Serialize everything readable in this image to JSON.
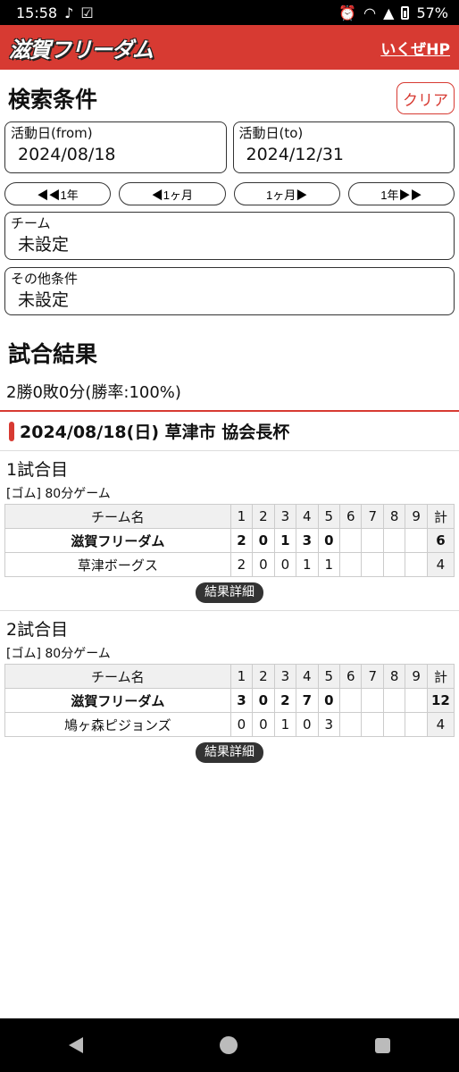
{
  "status": {
    "time": "15:58",
    "battery": "57%"
  },
  "app": {
    "logo": "滋賀フリーダム",
    "hp_link": "いくぜHP"
  },
  "search": {
    "title": "検索条件",
    "clear": "クリア",
    "from_label": "活動日(from)",
    "from_value": "2024/08/18",
    "to_label": "活動日(to)",
    "to_value": "2024/12/31",
    "nav": [
      "◀◀1年",
      "◀1ヶ月",
      "1ヶ月▶",
      "1年▶▶"
    ],
    "team_label": "チーム",
    "team_value": "未設定",
    "other_label": "その他条件",
    "other_value": "未設定"
  },
  "results": {
    "title": "試合結果",
    "record": "2勝0敗0分(勝率:100%)",
    "event": "2024/08/18(日) 草津市 協会長杯",
    "games": [
      {
        "title": "1試合目",
        "type": "[ゴム] 80分ゲーム",
        "header": [
          "チーム名",
          "1",
          "2",
          "3",
          "4",
          "5",
          "6",
          "7",
          "8",
          "9",
          "計"
        ],
        "rows": [
          {
            "team": "滋賀フリーダム",
            "scores": [
              "2",
              "0",
              "1",
              "3",
              "0",
              "",
              "",
              "",
              ""
            ],
            "total": "6",
            "bold": true
          },
          {
            "team": "草津ボーグス",
            "scores": [
              "2",
              "0",
              "0",
              "1",
              "1",
              "",
              "",
              "",
              ""
            ],
            "total": "4",
            "bold": false
          }
        ],
        "detail": "結果詳細"
      },
      {
        "title": "2試合目",
        "type": "[ゴム] 80分ゲーム",
        "header": [
          "チーム名",
          "1",
          "2",
          "3",
          "4",
          "5",
          "6",
          "7",
          "8",
          "9",
          "計"
        ],
        "rows": [
          {
            "team": "滋賀フリーダム",
            "scores": [
              "3",
              "0",
              "2",
              "7",
              "0",
              "",
              "",
              "",
              ""
            ],
            "total": "12",
            "bold": true
          },
          {
            "team": "鳩ヶ森ピジョンズ",
            "scores": [
              "0",
              "0",
              "1",
              "0",
              "3",
              "",
              "",
              "",
              ""
            ],
            "total": "4",
            "bold": false
          }
        ],
        "detail": "結果詳細"
      }
    ]
  }
}
